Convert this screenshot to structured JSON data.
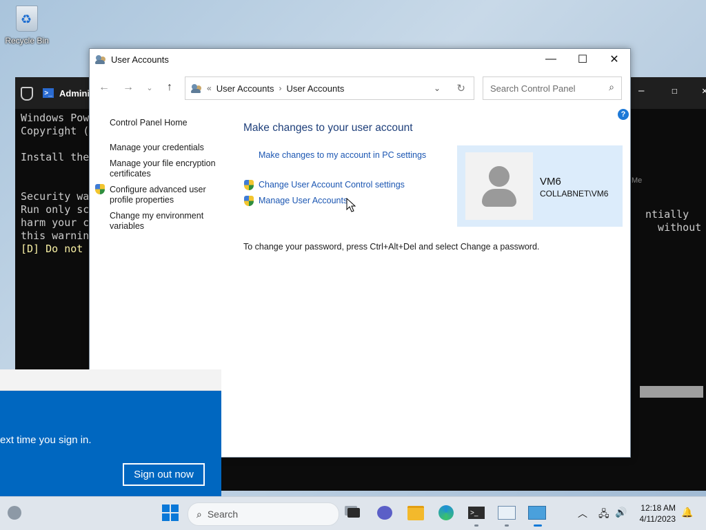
{
  "desktop": {
    "recycle_bin_label": "Recycle Bin"
  },
  "terminal": {
    "tab_title": "Admini",
    "lines": [
      "Windows Pow",
      "Copyright (",
      "",
      "Install the",
      "",
      "",
      "Security wa",
      "Run only sc",
      "harm your c",
      "this warnin",
      "[D] Do not "
    ],
    "right_lines": [
      "ntially",
      "  without"
    ],
    "side_label": "Me"
  },
  "window": {
    "title": "User Accounts",
    "controls": {
      "minimize": "—",
      "maximize": "☐",
      "close": "✕"
    },
    "address": {
      "prefix": "«",
      "crumbs": [
        "User Accounts",
        "User Accounts"
      ],
      "separator": "›"
    },
    "search": {
      "placeholder": "Search Control Panel"
    },
    "help": "?",
    "left_nav": {
      "home": "Control Panel Home",
      "credentials": "Manage your credentials",
      "encryption": "Manage your file encryption certificates",
      "profile": "Configure advanced user profile properties",
      "env": "Change my environment variables"
    },
    "heading": "Make changes to your user account",
    "links": {
      "pc_settings": "Make changes to my account in PC settings",
      "uac": "Change User Account Control settings",
      "manage": "Manage User Accounts"
    },
    "user": {
      "name": "VM6",
      "domain": "COLLABNET\\VM6"
    },
    "note": "To change your password, press Ctrl+Alt+Del and select Change a password."
  },
  "notification": {
    "message": "ext time you sign in.",
    "button": "Sign out now"
  },
  "taskbar": {
    "search_label": "Search",
    "time": "12:18 AM",
    "date": "4/11/2023"
  }
}
